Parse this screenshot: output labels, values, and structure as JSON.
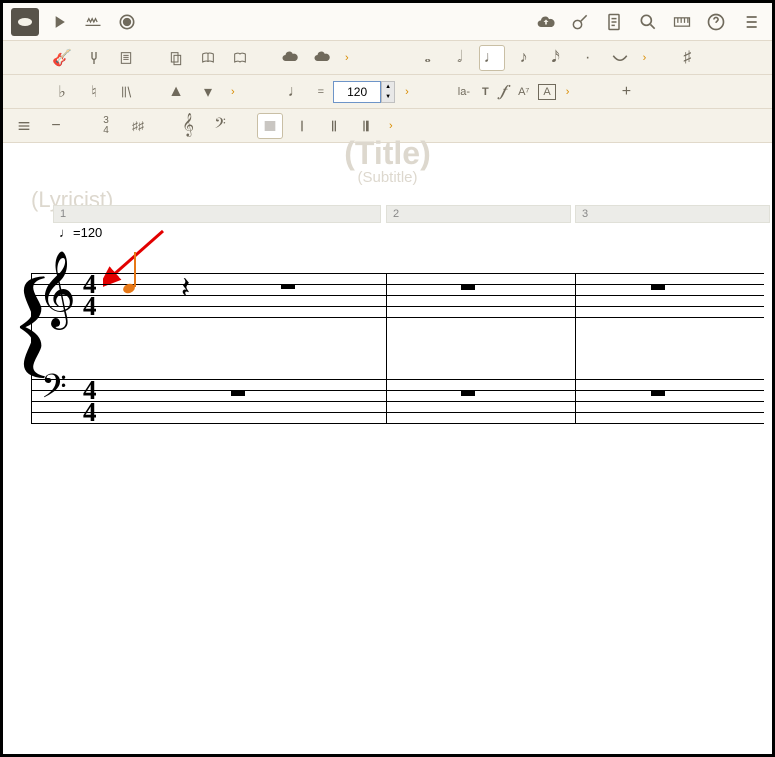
{
  "app": {
    "title_placeholder": "(Title)",
    "subtitle_placeholder": "(Subtitle)",
    "lyricist_placeholder": "(Lyricist)"
  },
  "tempo": {
    "input_value": "120",
    "marking_text": "=120"
  },
  "measures": {
    "numbers": [
      "1",
      "2",
      "3"
    ]
  },
  "score": {
    "time_signature_top": "4",
    "time_signature_bottom": "4",
    "treble_clef_symbol": "𝄞",
    "bass_clef_symbol": "𝄢"
  },
  "toolbar_row2": {
    "dot": "·",
    "plus": "+",
    "sharp": "♯"
  },
  "toolbar_row3": {
    "flat": "♭",
    "natural": "♮",
    "tempo_prefix": "♩ =",
    "la": "la-",
    "T": "T",
    "f": "𝆑",
    "A7": "A⁷",
    "A_box": "A",
    "plus": "+"
  },
  "toolbar_row4": {
    "three_four": "3\n4"
  }
}
